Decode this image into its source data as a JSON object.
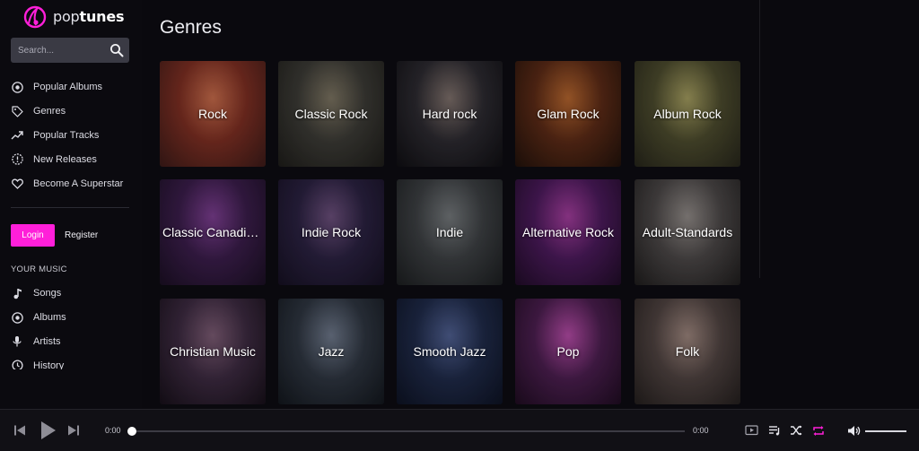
{
  "app": {
    "logo_pop": "pop",
    "logo_tunes": "tunes",
    "accent_color": "#ff1fd9"
  },
  "search": {
    "placeholder": "Search...",
    "icon": "search-icon"
  },
  "nav": {
    "items": [
      {
        "label": "Popular Albums",
        "icon": "disc-icon"
      },
      {
        "label": "Genres",
        "icon": "tag-icon"
      },
      {
        "label": "Popular Tracks",
        "icon": "trending-up-icon"
      },
      {
        "label": "New Releases",
        "icon": "new-badge-icon"
      },
      {
        "label": "Become A Superstar",
        "icon": "heart-icon"
      }
    ]
  },
  "auth": {
    "login_label": "Login",
    "register_label": "Register"
  },
  "your_music": {
    "heading": "YOUR MUSIC",
    "items": [
      {
        "label": "Songs",
        "icon": "music-note-icon"
      },
      {
        "label": "Albums",
        "icon": "disc-icon"
      },
      {
        "label": "Artists",
        "icon": "microphone-icon"
      },
      {
        "label": "History",
        "icon": "history-icon"
      }
    ]
  },
  "main": {
    "title": "Genres",
    "genres": [
      {
        "label": "Rock",
        "colors": [
          "#7b2e22",
          "#c46a4a",
          "#3a1a18"
        ]
      },
      {
        "label": "Classic Rock",
        "colors": [
          "#3b3a35",
          "#7a7260",
          "#1d1c19"
        ]
      },
      {
        "label": "Hard rock",
        "colors": [
          "#2c2a30",
          "#7d6f6a",
          "#0f0e12"
        ]
      },
      {
        "label": "Glam Rock",
        "colors": [
          "#5a2a16",
          "#b2642e",
          "#20110b"
        ]
      },
      {
        "label": "Album Rock",
        "colors": [
          "#4b4a2d",
          "#a19a5e",
          "#25241a"
        ]
      },
      {
        "label": "Classic Canadian Rock",
        "colors": [
          "#3a1d4a",
          "#7a3d8e",
          "#1a0f22"
        ]
      },
      {
        "label": "Indie Rock",
        "colors": [
          "#2a2140",
          "#6a4e7a",
          "#151021"
        ]
      },
      {
        "label": "Indie",
        "colors": [
          "#3c3f42",
          "#727679",
          "#1b1d1f"
        ]
      },
      {
        "label": "Alternative Rock",
        "colors": [
          "#4a1a5a",
          "#a03c9a",
          "#1f0c26"
        ]
      },
      {
        "label": "Adult-Standards",
        "colors": [
          "#4a4646",
          "#8e8885",
          "#1e1c1c"
        ]
      },
      {
        "label": "Christian Music",
        "colors": [
          "#3c2a40",
          "#7a5a72",
          "#160f18"
        ]
      },
      {
        "label": "Jazz",
        "colors": [
          "#2e3540",
          "#6c7688",
          "#12161c"
        ]
      },
      {
        "label": "Smooth Jazz",
        "colors": [
          "#1f2a48",
          "#4e5e8e",
          "#0d1222"
        ]
      },
      {
        "label": "Pop",
        "colors": [
          "#4a1e4e",
          "#b24aa4",
          "#1e0c20"
        ]
      },
      {
        "label": "Folk",
        "colors": [
          "#4e4240",
          "#9a837b",
          "#231e1d"
        ]
      }
    ]
  },
  "player": {
    "current_time": "0:00",
    "total_time": "0:00",
    "progress": 0,
    "volume": 1,
    "repeat_color": "#ff1fd9"
  }
}
